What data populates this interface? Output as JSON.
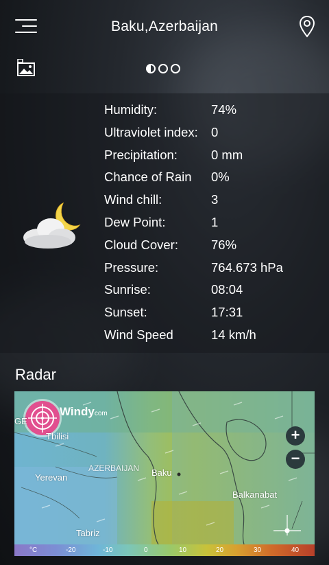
{
  "header": {
    "city": "Baku,Azerbaijan",
    "menu_icon": "hamburger-menu-icon",
    "location_icon": "location-pin-icon"
  },
  "wallpaper_icon": "image-lock-icon",
  "pager": {
    "pages": 3,
    "active_index": 0
  },
  "current": {
    "condition_icon": "partly-cloudy-night-icon",
    "details": [
      {
        "label": "Humidity:",
        "value": "74%"
      },
      {
        "label": "Ultraviolet index:",
        "value": "0"
      },
      {
        "label": "Precipitation:",
        "value": "0 mm"
      },
      {
        "label": "Chance of Rain",
        "value": "0%"
      },
      {
        "label": "Wind chill:",
        "value": "3"
      },
      {
        "label": "Dew Point:",
        "value": "1"
      },
      {
        "label": "Cloud Cover:",
        "value": "76%"
      },
      {
        "label": "Pressure:",
        "value": "764.673 hPa"
      },
      {
        "label": "Sunrise:",
        "value": "08:04"
      },
      {
        "label": "Sunset:",
        "value": "17:31"
      },
      {
        "label": "Wind Speed",
        "value": "14 km/h"
      }
    ]
  },
  "radar": {
    "title": "Radar",
    "brand": "Windy",
    "brand_suffix": "com",
    "zoom_in": "+",
    "zoom_out": "−",
    "places": {
      "tbilisi": "Tbilisi",
      "yerevan": "Yerevan",
      "azerbaijan": "AZERBAIJAN",
      "baku": "Baku",
      "balkanabat": "Balkanabat",
      "tabriz": "Tabriz",
      "georgia_partial": "GE"
    },
    "legend": [
      "°C",
      "-20",
      "-10",
      "0",
      "10",
      "20",
      "30",
      "40"
    ]
  }
}
